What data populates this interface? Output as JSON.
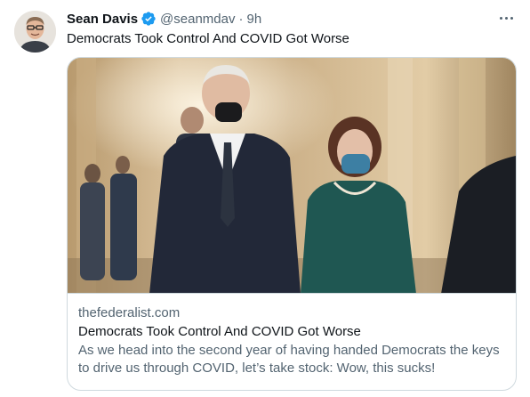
{
  "author": {
    "name": "Sean Davis",
    "handle": "@seanmdav",
    "separator": "·",
    "time": "9h",
    "verified": true
  },
  "tweet": {
    "text": "Democrats Took Control And COVID Got Worse"
  },
  "card": {
    "domain": "thefederalist.com",
    "title": "Democrats Took Control And COVID Got Worse",
    "description": "As we head into the second year of having handed Democrats the keys to drive us through COVID, let’s take stock: Wow, this sucks!"
  },
  "icons": {
    "verified": "verified-badge-icon",
    "more": "more-options-icon"
  },
  "colors": {
    "text": "#0f1419",
    "secondary": "#536471",
    "verified": "#1d9bf0",
    "border": "#cfd9de"
  }
}
